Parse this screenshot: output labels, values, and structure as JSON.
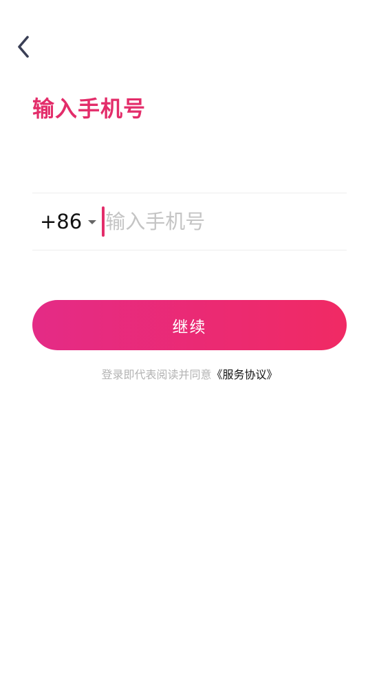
{
  "header": {
    "back_icon": "chevron-left-icon"
  },
  "page": {
    "title": "输入手机号"
  },
  "phone": {
    "country_code": "+86",
    "dropdown_icon": "caret-down-icon",
    "value": "",
    "placeholder": "输入手机号"
  },
  "actions": {
    "continue_label": "继续"
  },
  "agreement": {
    "prefix": "登录即代表阅读并同意",
    "link_label": "《服务协议》"
  },
  "colors": {
    "accent": "#e32d6a",
    "button_gradient_start": "#e42b86",
    "button_gradient_end": "#f02a64",
    "placeholder": "#c4c4c4",
    "divider": "#ececec"
  }
}
